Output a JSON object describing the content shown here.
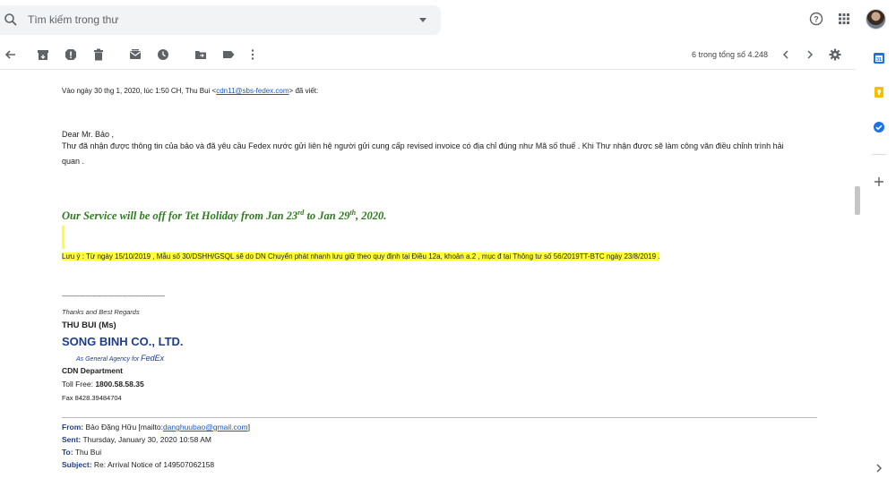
{
  "search": {
    "placeholder": "Tìm kiếm trong thư"
  },
  "pager": {
    "text": "6 trong tổng số 4.248"
  },
  "mail": {
    "quote_header_prefix": "Vào ngày 30 thg 1, 2020, lúc 1:50 CH, Thu Bui <",
    "quote_header_email": "cdn11@sbs-fedex.com",
    "quote_header_suffix": "> đã viết:",
    "greeting": "Dear Mr. Bảo ,",
    "body_line1": "Thư đã nhận được thông tin của bảo và đã yêu cầu Fedex nước gửi liên hệ người gửi cung cấp revised invoice có địa chỉ đúng như Mã số thuế . Khi Thư nhận được sẽ làm công văn điều chỉnh trình hải",
    "body_line2": "quan .",
    "promo_a": "Our Service will be off for Tet Holiday from Jan 23",
    "promo_sup1": "rd",
    "promo_b": " to Jan 29",
    "promo_sup2": "th",
    "promo_c": ", 2020.",
    "notice": "Lưu ý : Từ ngày 15/10/2019 , Mẫu số 30/DSHH/GSQL  sẽ do DN Chuyển phát nhanh lưu giữ theo  quy định tại  Điều 12a,  khoản a.2 , mục đ tại Thông tư số 56/2019TT-BTC ngày 23/8/2019 .",
    "sig_divider": "-----------------------------------------------------",
    "sig_thanks": "Thanks and Best Regards",
    "sig_name": "THU BUI  (Ms)",
    "sig_company": "SONG BINH CO., LTD.",
    "sig_agency_prefix": "As General Agency for ",
    "sig_agency_brand": "FedEx",
    "sig_dept": "CDN Department",
    "sig_toll_label": "Toll Free:  ",
    "sig_toll_number": "1800.58.58.35",
    "sig_fax": "Fax  8428.39484704",
    "from_label": "From:",
    "from_value": " Bảo Đặng Hữu [mailto:",
    "from_email": "danghuubao@gmail.com",
    "from_end": "]",
    "sent_label": "Sent:",
    "sent_value": " Thursday, January 30, 2020 10:58 AM",
    "to_label": "To:",
    "to_value": " Thu Bui",
    "subject_label": "Subject:",
    "subject_value": " Re: Arrival Notice of 149507062158"
  },
  "icons": [
    "search-icon",
    "caret-down-icon",
    "help-icon",
    "apps-grid-icon",
    "back-arrow-icon",
    "archive-icon",
    "report-spam-icon",
    "delete-icon",
    "mark-unread-icon",
    "snooze-icon",
    "move-to-icon",
    "label-icon",
    "more-vert-icon",
    "chevron-left-icon",
    "chevron-right-icon",
    "settings-gear-icon",
    "calendar-icon",
    "keep-icon",
    "tasks-icon",
    "add-icon"
  ],
  "colors": {
    "accent_blue": "#1a73e8",
    "highlight": "#ffff33",
    "promo_green": "#2e7d1f",
    "company_blue": "#1f3d8a"
  }
}
